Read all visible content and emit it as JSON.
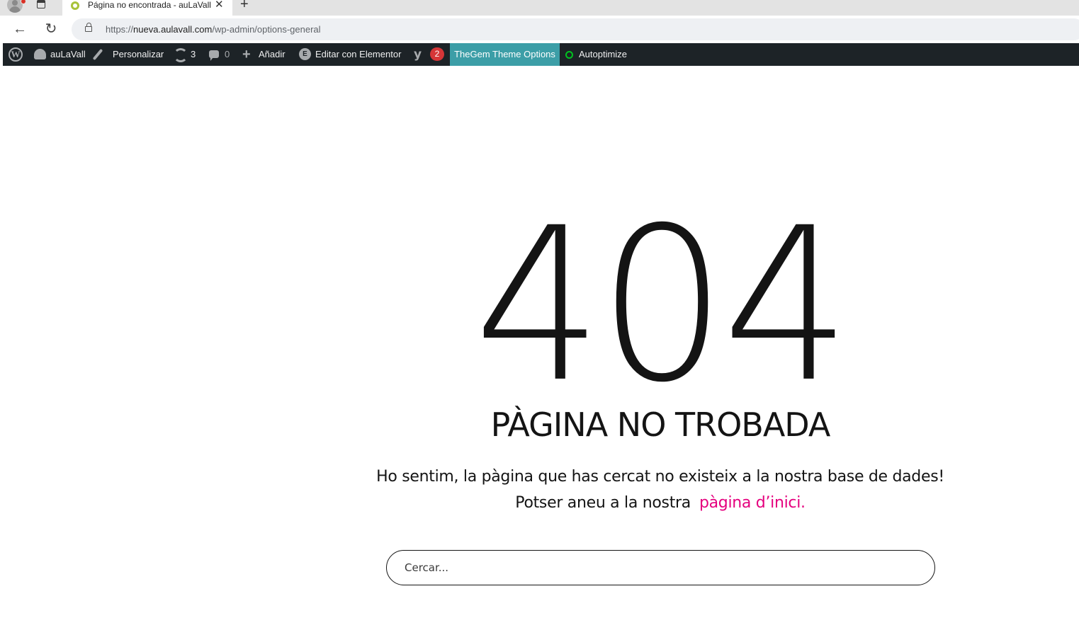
{
  "browser": {
    "tab_title": "Página no encontrada - auLaVall",
    "tab_close": "✕",
    "new_tab": "+",
    "url_scheme": "https://",
    "url_host": "nueva.aulavall.com",
    "url_path": "/wp-admin/options-general"
  },
  "adminbar": {
    "site_name": "auLaVall",
    "customize": "Personalizar",
    "updates_count": "3",
    "comments_count": "0",
    "add_new": "Añadir",
    "edit_elementor": "Editar con Elementor",
    "yoast_count": "2",
    "thegem_options": "TheGem Theme Options",
    "autoptimize": "Autoptimize"
  },
  "content": {
    "code": "404",
    "heading": "PÀGINA NO TROBADA",
    "message_line1": "Ho sentim, la pàgina que has cercat no existeix a la nostra base de dades!",
    "message_line2_prefix": "Potser aneu a la nostra",
    "home_link": "pàgina d’inici.",
    "search_placeholder": "Cercar..."
  },
  "colors": {
    "adminbar_bg": "#1d2327",
    "thegem_bg": "#3c9ea7",
    "link": "#e5007e",
    "text": "#141414"
  }
}
